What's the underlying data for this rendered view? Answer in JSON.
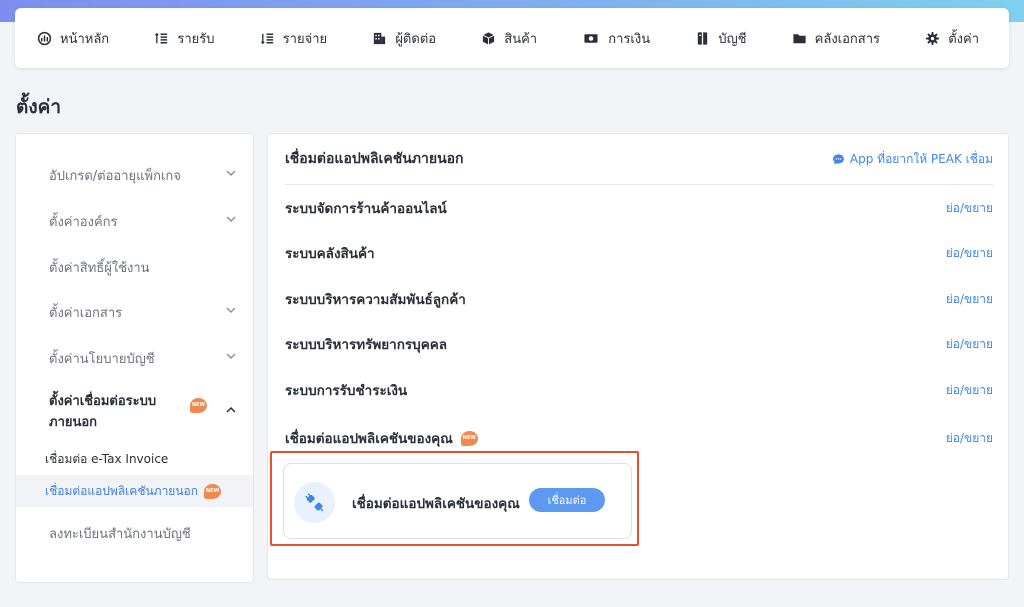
{
  "colors": {
    "accent": "#3f86e6",
    "button": "#5b9af0",
    "highlight": "#e4512f",
    "badge": "#f0894f"
  },
  "nav": {
    "items": [
      {
        "key": "home",
        "label": "หน้าหลัก",
        "icon": "dashboard-icon"
      },
      {
        "key": "income",
        "label": "รายรับ",
        "icon": "income-list-icon"
      },
      {
        "key": "expense",
        "label": "รายจ่าย",
        "icon": "expense-list-icon"
      },
      {
        "key": "contacts",
        "label": "ผู้ติดต่อ",
        "icon": "contacts-icon"
      },
      {
        "key": "products",
        "label": "สินค้า",
        "icon": "box-icon"
      },
      {
        "key": "finance",
        "label": "การเงิน",
        "icon": "money-icon"
      },
      {
        "key": "accounting",
        "label": "บัญชี",
        "icon": "ledger-icon"
      },
      {
        "key": "documents",
        "label": "คลังเอกสาร",
        "icon": "folder-icon"
      },
      {
        "key": "settings",
        "label": "ตั้งค่า",
        "icon": "gear-icon"
      }
    ]
  },
  "page": {
    "title": "ตั้งค่า"
  },
  "sidebar": {
    "items": [
      {
        "label": "อัปเกรด/ต่ออายุแพ็กเกจ",
        "chevron": "down"
      },
      {
        "label": "ตั้งค่าองค์กร",
        "chevron": "down"
      },
      {
        "label": "ตั้งค่าสิทธิ์ผู้ใช้งาน",
        "chevron": ""
      },
      {
        "label": "ตั้งค่าเอกสาร",
        "chevron": "down"
      },
      {
        "label": "ตั้งค่านโยบายบัญชี",
        "chevron": "down"
      },
      {
        "label_line1": "ตั้งค่าเชื่อมต่อระบบ",
        "label_line2": "ภายนอก",
        "chevron": "up",
        "badge": "NEW"
      }
    ],
    "sub_items": [
      {
        "label": "เชื่อมต่อ e-Tax Invoice"
      },
      {
        "label": "เชื่อมต่อแอปพลิเคชันภายนอก",
        "badge": "NEW",
        "selected": true
      }
    ],
    "extra_item": {
      "label": "ลงทะเบียนสำนักงานบัญชี"
    }
  },
  "main": {
    "title": "เชื่อมต่อแอปพลิเคชันภายนอก",
    "request_link": "App ที่อยากให้ PEAK เชื่อม",
    "toggle_label": "ย่อ/ขยาย",
    "categories": [
      {
        "name": "ระบบจัดการร้านค้าออนไลน์"
      },
      {
        "name": "ระบบคลังสินค้า"
      },
      {
        "name": "ระบบบริหารความสัมพันธ์ลูกค้า"
      },
      {
        "name": "ระบบบริหารทรัพยากรบุคคล"
      },
      {
        "name": "ระบบการรับชำระเงิน"
      },
      {
        "name": "เชื่อมต่อแอปพลิเคชันของคุณ",
        "badge": "NEW"
      }
    ],
    "connect_card": {
      "text": "เชื่อมต่อแอปพลิเคชันของคุณ",
      "button": "เชื่อมต่อ"
    }
  }
}
